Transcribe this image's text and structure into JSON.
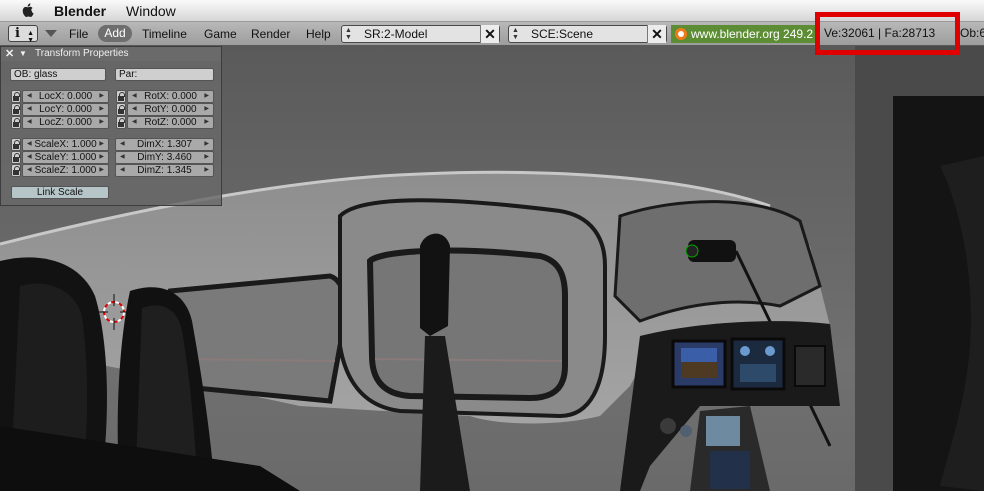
{
  "menubar": {
    "app_name": "Blender",
    "window_menu": "Window"
  },
  "header": {
    "menus": [
      "File",
      "Add",
      "Timeline",
      "Game",
      "Render",
      "Help"
    ],
    "screen": "SR:2-Model",
    "scene": "SCE:Scene",
    "site_text": "www.blender.org 249.2",
    "stats": "Ve:32061 | Fa:28713",
    "obj_trunc": "Ob:6"
  },
  "panel": {
    "title": "Transform Properties",
    "ob_label": "OB: glass",
    "par_label": "Par:",
    "loc": [
      "LocX: 0.000",
      "LocY: 0.000",
      "LocZ: 0.000"
    ],
    "rot": [
      "RotX: 0.000",
      "RotY: 0.000",
      "RotZ: 0.000"
    ],
    "scale": [
      "ScaleX: 1.000",
      "ScaleY: 1.000",
      "ScaleZ: 1.000"
    ],
    "dim": [
      "DimX: 1.307",
      "DimY: 3.460",
      "DimZ: 1.345"
    ],
    "link_scale": "Link Scale"
  },
  "highlight_color": "#e00000",
  "icons": [
    "apple-icon",
    "info-icon",
    "menu-triangle-icon",
    "close-icon",
    "blender-logo-icon",
    "lock-icon",
    "cursor-3d-icon"
  ]
}
